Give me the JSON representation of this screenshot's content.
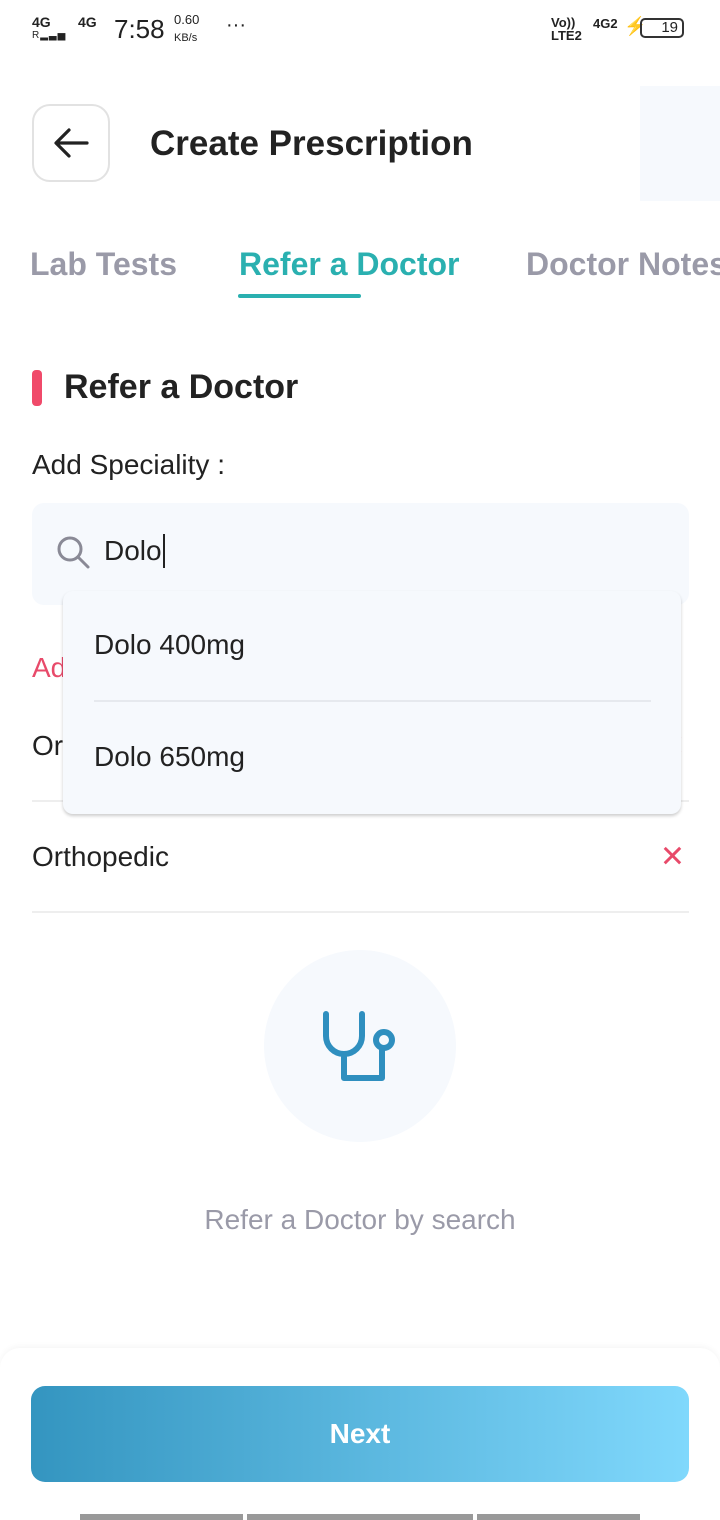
{
  "status_bar": {
    "signal1": "4G",
    "signal2": "4G",
    "time": "7:58",
    "speed": "0.60",
    "speed_unit": "KB/s",
    "more": "···",
    "volte": "Vo)) LTE2",
    "net": "4G2",
    "battery": "19"
  },
  "header": {
    "title": "Create Prescription",
    "back_icon": "arrow-left-icon"
  },
  "tabs": [
    {
      "label": "Lab Tests",
      "active": false
    },
    {
      "label": "Refer a Doctor",
      "active": true
    },
    {
      "label": "Doctor Notes",
      "active": false
    }
  ],
  "section": {
    "title": "Refer a Doctor",
    "accent": "#f04a6a",
    "add_label": "Add Speciality :"
  },
  "search": {
    "value": "Dolo",
    "icon": "search-icon"
  },
  "suggestions": [
    "Dolo 400mg",
    "Dolo 650mg"
  ],
  "hidden_partial": {
    "added_label": "Ad",
    "row1": "Or"
  },
  "specialities": [
    {
      "label": "Orthopedic"
    }
  ],
  "empty_state": {
    "icon": "stethoscope-icon",
    "text": "Refer a Doctor by search"
  },
  "footer": {
    "next_label": "Next"
  },
  "colors": {
    "teal": "#2ab0b0",
    "pink": "#e84a6a",
    "gradient_start": "#3495c0",
    "gradient_end": "#80d8fc"
  }
}
